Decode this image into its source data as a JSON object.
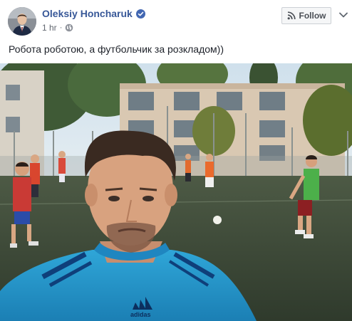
{
  "post": {
    "author_name": "Oleksiy Honcharuk",
    "timestamp": "1 hr",
    "separator": "·",
    "privacy_icon": "globe-icon",
    "verified_icon": "verified-badge-icon",
    "text": "Робота роботою, а футбольчик за розкладом))"
  },
  "actions": {
    "follow_label": "Follow",
    "follow_icon": "rss-icon",
    "more_icon": "chevron-down-icon"
  },
  "photo": {
    "description_icon": "post-photo"
  },
  "colors": {
    "link_blue": "#385898",
    "verified_blue": "#4267b2",
    "meta_gray": "#616770",
    "button_bg": "#f5f6f7",
    "button_border": "#ccd0d5"
  }
}
